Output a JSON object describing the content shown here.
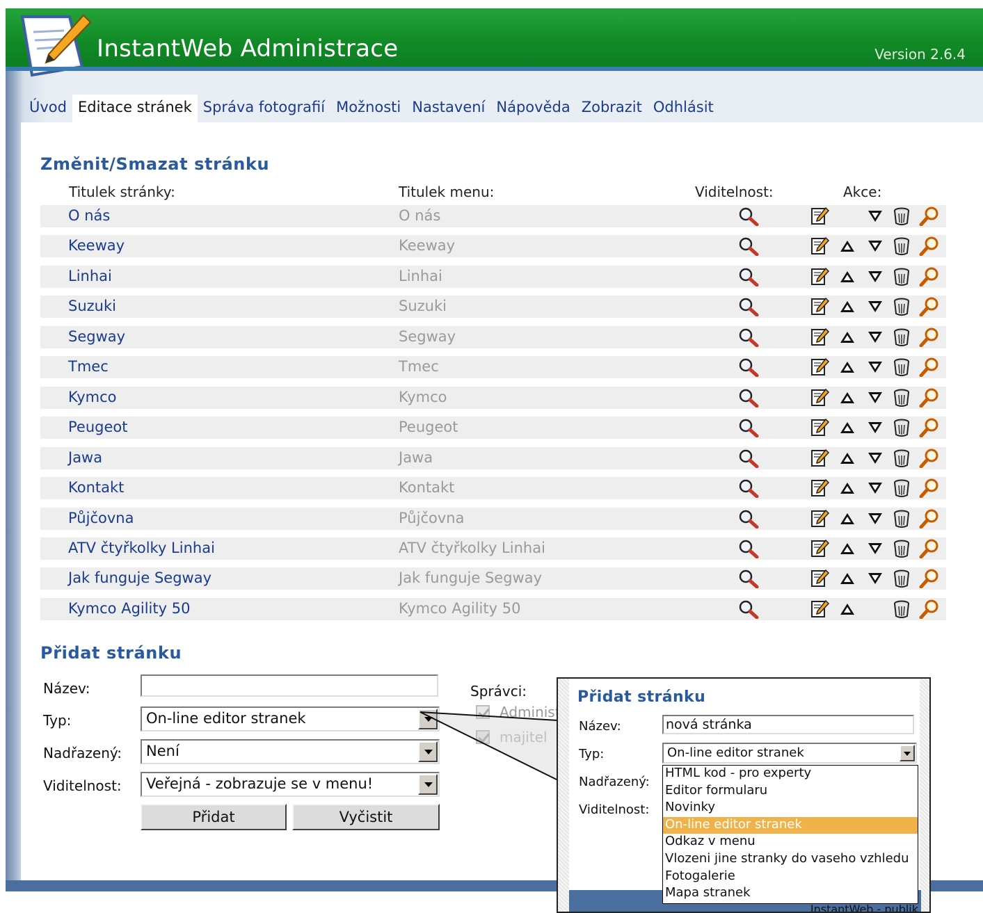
{
  "app": {
    "title": "InstantWeb Administrace",
    "version": "Version 2.6.4"
  },
  "nav": [
    {
      "label": "Úvod",
      "active": false
    },
    {
      "label": "Editace stránek",
      "active": true
    },
    {
      "label": "Správa fotografií",
      "active": false
    },
    {
      "label": "Možnosti",
      "active": false
    },
    {
      "label": "Nastavení",
      "active": false
    },
    {
      "label": "Nápověda",
      "active": false
    },
    {
      "label": "Zobrazit",
      "active": false
    },
    {
      "label": "Odhlásit",
      "active": false
    }
  ],
  "list": {
    "heading": "Změnit/Smazat stránku",
    "columns": {
      "page_title": "Titulek stránky:",
      "menu_title": "Titulek menu:",
      "visibility": "Viditelnost:",
      "actions": "Akce:"
    },
    "rows": [
      {
        "title": "O nás",
        "menu": "O nás",
        "up": false,
        "down": true
      },
      {
        "title": "Keeway",
        "menu": "Keeway",
        "up": true,
        "down": true
      },
      {
        "title": "Linhai",
        "menu": "Linhai",
        "up": true,
        "down": true
      },
      {
        "title": "Suzuki",
        "menu": "Suzuki",
        "up": true,
        "down": true
      },
      {
        "title": "Segway",
        "menu": "Segway",
        "up": true,
        "down": true
      },
      {
        "title": "Tmec",
        "menu": "Tmec",
        "up": true,
        "down": true
      },
      {
        "title": "Kymco",
        "menu": "Kymco",
        "up": true,
        "down": true
      },
      {
        "title": "Peugeot",
        "menu": "Peugeot",
        "up": true,
        "down": true
      },
      {
        "title": "Jawa",
        "menu": "Jawa",
        "up": true,
        "down": true
      },
      {
        "title": "Kontakt",
        "menu": "Kontakt",
        "up": true,
        "down": true
      },
      {
        "title": "Půjčovna",
        "menu": "Půjčovna",
        "up": true,
        "down": true
      },
      {
        "title": "ATV čtyřkolky Linhai",
        "menu": "ATV čtyřkolky Linhai",
        "up": true,
        "down": true
      },
      {
        "title": "Jak funguje Segway",
        "menu": "Jak funguje Segway",
        "up": true,
        "down": true
      },
      {
        "title": "Kymco Agility 50",
        "menu": "Kymco Agility 50",
        "up": true,
        "down": false
      }
    ]
  },
  "add_form": {
    "heading": "Přidat stránku",
    "name_label": "Název:",
    "name_value": "",
    "type_label": "Typ:",
    "type_value": "On-line editor stranek",
    "parent_label": "Nadřazený:",
    "parent_value": "Není",
    "visibility_label": "Viditelnost:",
    "visibility_value": "Veřejná - zobrazuje se v menu!",
    "add_button": "Přidat",
    "clear_button": "Vyčistit",
    "admins_label": "Správci:",
    "admins": [
      {
        "label": "Administ",
        "checked": true
      },
      {
        "label": "majitel",
        "checked": true
      }
    ]
  },
  "callout": {
    "heading": "Přidat stránku",
    "name_label": "Název:",
    "name_value": "nová stránka",
    "type_label": "Typ:",
    "type_value": "On-line editor stranek",
    "parent_label": "Nadřazený:",
    "visibility_label": "Viditelnost:",
    "options": [
      {
        "label": "HTML kod - pro experty",
        "selected": false
      },
      {
        "label": "Editor formularu",
        "selected": false
      },
      {
        "label": "Novinky",
        "selected": false
      },
      {
        "label": "On-line editor stranek",
        "selected": true
      },
      {
        "label": "Odkaz v menu",
        "selected": false
      },
      {
        "label": "Vlozeni jine stranky do vaseho vzhledu",
        "selected": false
      },
      {
        "label": "Fotogalerie",
        "selected": false
      },
      {
        "label": "Mapa stranek",
        "selected": false
      }
    ],
    "footer_text": "InstantWeb - publik"
  },
  "icons": [
    "logo-icon",
    "visibility-icon",
    "edit-icon",
    "move-up-icon",
    "move-down-icon",
    "delete-icon",
    "preview-icon",
    "dropdown-arrow-icon",
    "checkbox-icon"
  ],
  "colors": {
    "header_green": "#118a26",
    "link_blue": "#1a3c8c",
    "heading_blue": "#2a5a9e",
    "selected_option": "#f2b24a"
  }
}
